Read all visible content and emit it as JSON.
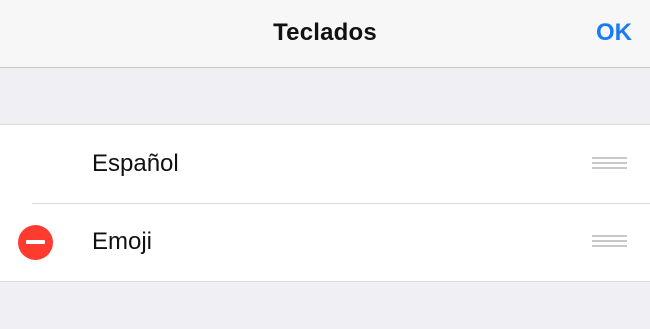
{
  "navbar": {
    "title": "Teclados",
    "done_label": "OK",
    "accent_color": "#1a7cf5"
  },
  "keyboards": [
    {
      "label": "Español",
      "show_delete": false
    },
    {
      "label": "Emoji",
      "show_delete": true
    }
  ],
  "icons": {
    "delete": "minus-circle-icon",
    "reorder": "reorder-grabber-icon"
  },
  "colors": {
    "delete_red": "#ff3b30",
    "background": "#efeff4"
  }
}
